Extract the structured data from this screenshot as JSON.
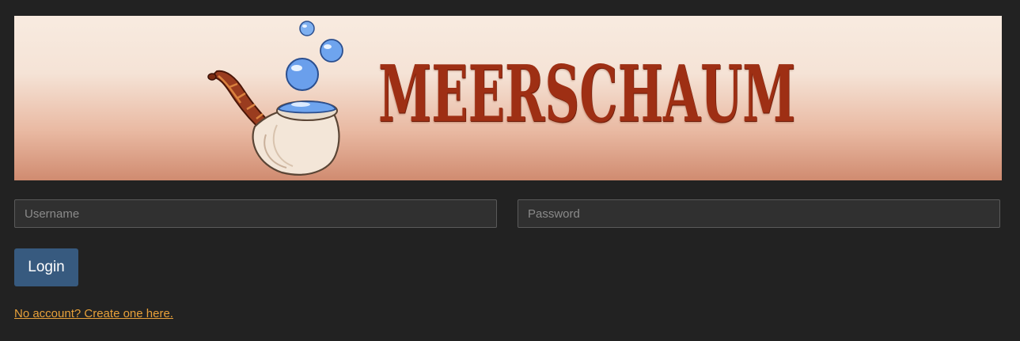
{
  "banner": {
    "brand_name": "Meerschaum",
    "logo_title": "MEERSCHAUM",
    "logo_icon": "pipe-with-bubbles-icon",
    "colors": {
      "text": "#9e2f14",
      "bubble": "#6b9ee8",
      "pipe_bowl": "#f5e9dc",
      "stem": "#9a3c1f"
    }
  },
  "form": {
    "username_placeholder": "Username",
    "username_value": "",
    "password_placeholder": "Password",
    "password_value": "",
    "login_label": "Login",
    "signup_link_text": "No account? Create one here."
  },
  "colors": {
    "background": "#222222",
    "button": "#375a7f",
    "link": "#e8a13a"
  }
}
